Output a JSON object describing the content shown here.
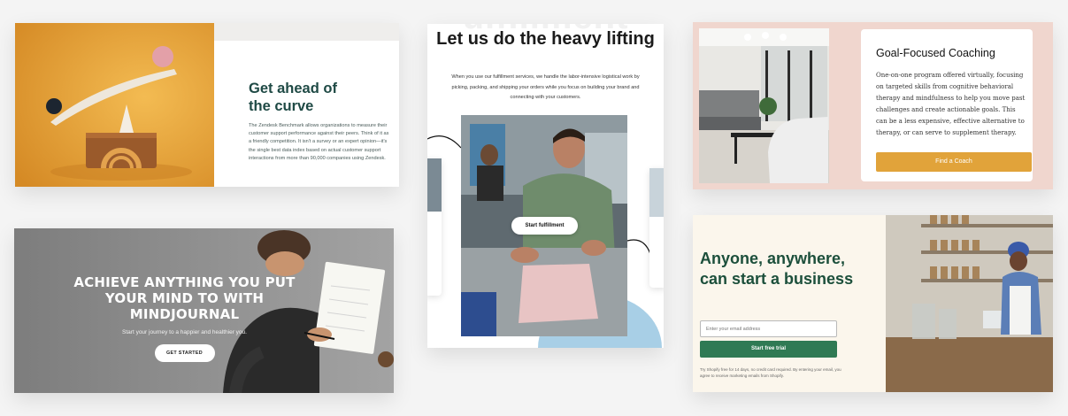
{
  "zendesk": {
    "title_line1": "Get ahead of",
    "title_line2": "the curve",
    "body": "The Zendesk Benchmark allows organizations to measure their customer support performance against their peers. Think of it as a friendly competition. It isn't a survey or an expert opinion—it's the single best data index based on actual customer support interactions from more than 90,000 companies using Zendesk."
  },
  "mindjournal": {
    "title": "Achieve anything you put your mind to with MindJournal",
    "subtitle": "Start your journey to a happier and healthier you.",
    "cta": "GET STARTED"
  },
  "fulfillment": {
    "ghost": "ulfillment",
    "title": "Let us do the heavy lifting",
    "body": "When you use our fulfillment services, we handle the labor-intensive logistical work by picking, packing, and shipping your orders while you focus on building your brand and connecting with your customers.",
    "cta": "Start fulfillment"
  },
  "coaching": {
    "title": "Goal-Focused Coaching",
    "body": "One-on-one program offered virtually, focusing on targeted skills from cognitive behavioral therapy and mindfulness to help you move past challenges and create actionable goals. This can be a less expensive, effective alternative to therapy, or can serve to supplement therapy.",
    "cta": "Find a Coach"
  },
  "business": {
    "title": "Anyone, anywhere, can start a business",
    "email_placeholder": "Enter your email address",
    "cta": "Start free trial",
    "legal": "Try Shopify free for 14 days, no credit card required. By entering your email, you agree to receive marketing emails from Shopify."
  },
  "colors": {
    "zendesk_green": "#1f4a45",
    "coaching_gold": "#e1a33a",
    "shopify_green": "#2f7a54",
    "coaching_bg": "#f0d6ce"
  }
}
